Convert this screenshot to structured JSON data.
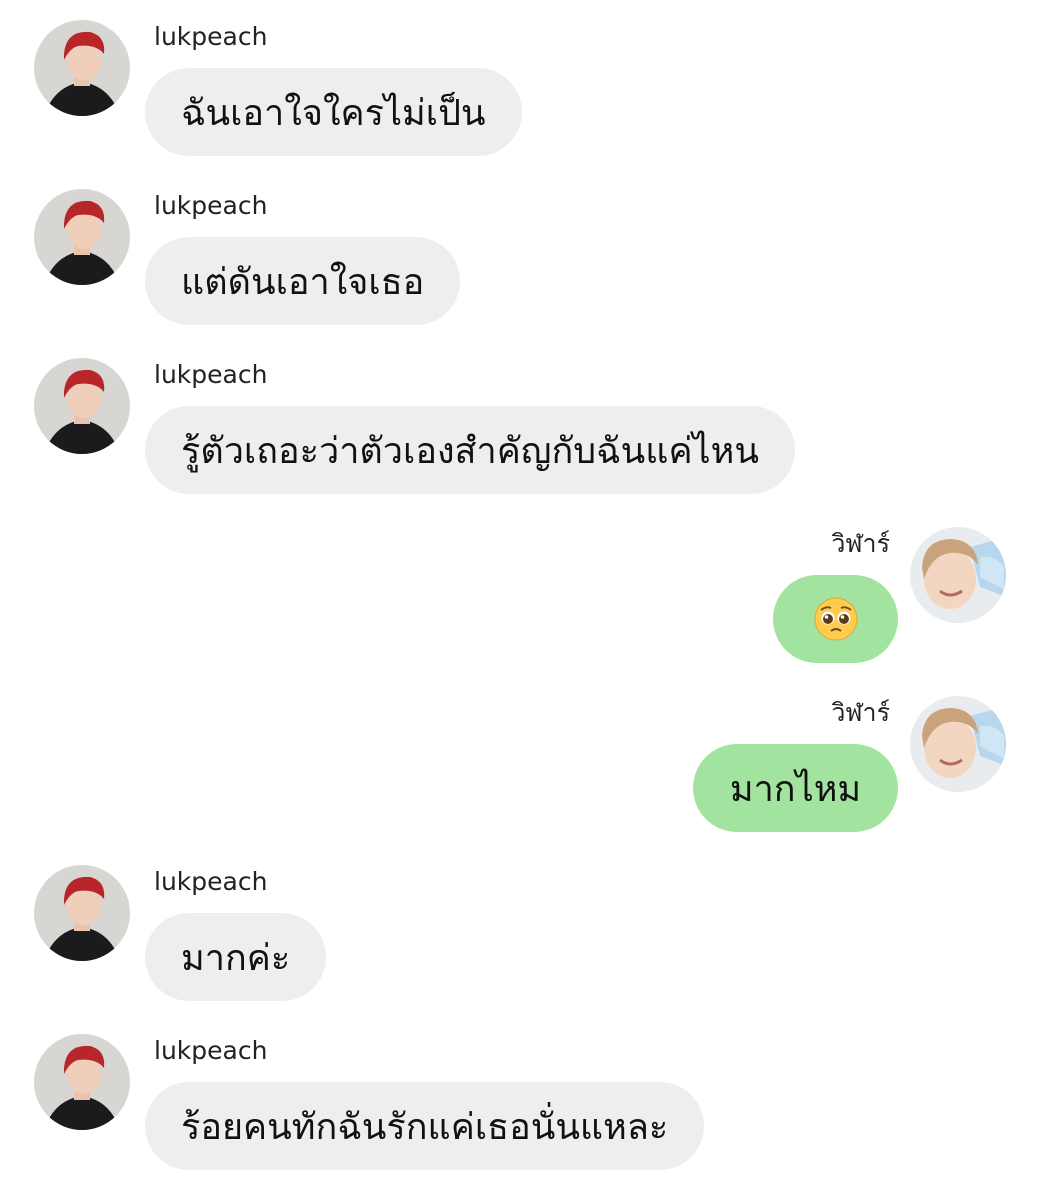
{
  "chat": {
    "messages": [
      {
        "side": "left",
        "sender": "lukpeach",
        "text": "ฉันเอาใจใครไม่เป็น"
      },
      {
        "side": "left",
        "sender": "lukpeach",
        "text": "แต่ดันเอาใจเธอ"
      },
      {
        "side": "left",
        "sender": "lukpeach",
        "text": "รู้ตัวเถอะว่าตัวเองสำคัญกับฉันแค่ไหน"
      },
      {
        "side": "right",
        "sender": "วิฬาร์",
        "text": "",
        "emoji": "pleading-face-emoji"
      },
      {
        "side": "right",
        "sender": "วิฬาร์",
        "text": "มากไหม"
      },
      {
        "side": "left",
        "sender": "lukpeach",
        "text": "มากค่ะ"
      },
      {
        "side": "left",
        "sender": "lukpeach",
        "text": "ร้อยคนทักฉันรักแค่เธอนั่นแหละ"
      }
    ]
  },
  "colors": {
    "incoming_bubble": "#eeeeee",
    "outgoing_bubble": "#a2e3a0",
    "background": "#ffffff"
  }
}
